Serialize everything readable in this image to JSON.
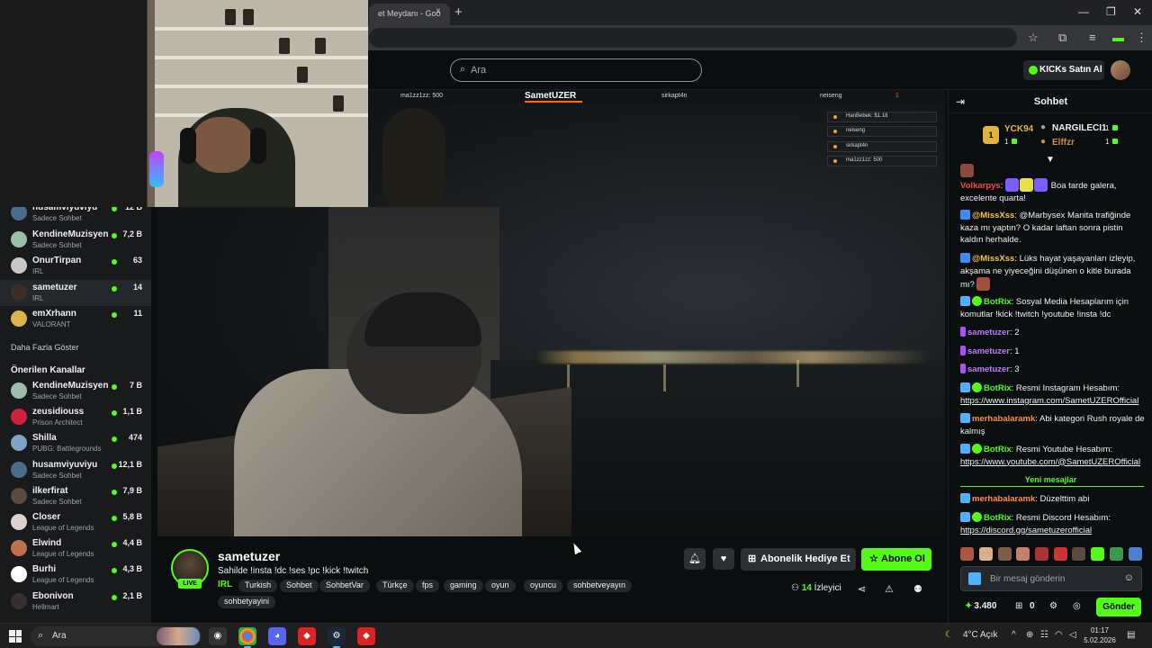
{
  "browser": {
    "tab_title": "et Meydanı - Goo",
    "tab_close": "×",
    "new_tab": "+",
    "window_controls": [
      "—",
      "❐",
      "✕"
    ]
  },
  "topnav": {
    "search_placeholder": "Ara",
    "kicks_button": "KICKs Satın Al"
  },
  "sidebar": {
    "following": [
      {
        "name": "husamviyuviyu",
        "category": "Sadece Sohbet",
        "viewers": "12 B",
        "avatar_color": "#4a6b8a"
      },
      {
        "name": "KendineMuzisyen",
        "category": "Sadece Sohbet",
        "viewers": "7,2 B",
        "avatar_color": "#9bbfa8"
      },
      {
        "name": "OnurTirpan",
        "category": "IRL",
        "viewers": "63",
        "avatar_color": "#c7c7c7"
      },
      {
        "name": "sametuzer",
        "category": "IRL",
        "viewers": "14",
        "avatar_color": "#3b2f28"
      },
      {
        "name": "emXrhann",
        "category": "VALORANT",
        "viewers": "11",
        "avatar_color": "#d9b54a"
      }
    ],
    "show_more": "Daha Fazla Göster",
    "recommended_title": "Önerilen Kanallar",
    "recommended": [
      {
        "name": "KendineMuzisyen",
        "category": "Sadece Sohbet",
        "viewers": "7 B",
        "avatar_color": "#9bbfa8"
      },
      {
        "name": "zeusidiouss",
        "category": "Prison Architect",
        "viewers": "1,1 B",
        "avatar_color": "#d02040"
      },
      {
        "name": "Shilla",
        "category": "PUBG: Battlegrounds",
        "viewers": "474",
        "avatar_color": "#7fa3c8"
      },
      {
        "name": "husamviyuviyu",
        "category": "Sadece Sohbet",
        "viewers": "12,1 B",
        "avatar_color": "#4a6b8a"
      },
      {
        "name": "ilkerfirat",
        "category": "Sadece Sohbet",
        "viewers": "7,9 B",
        "avatar_color": "#5a4a40"
      },
      {
        "name": "Closer",
        "category": "League of Legends",
        "viewers": "5,8 B",
        "avatar_color": "#e0d0d0"
      },
      {
        "name": "Elwind",
        "category": "League of Legends",
        "viewers": "4,4 B",
        "avatar_color": "#c0704a"
      },
      {
        "name": "Burhi",
        "category": "League of Legends",
        "viewers": "4,3 B",
        "avatar_color": "#ffffff"
      },
      {
        "name": "Ebonivon",
        "category": "Hellmart",
        "viewers": "2,1 B",
        "avatar_color": "#3a2f2f"
      }
    ]
  },
  "overlay": {
    "left_cell": "ma1zz1zz: 500",
    "main": "SametUZER",
    "cell_3": "sirkapt4n",
    "cell_4": "neiseng",
    "cell_5": "1",
    "list": [
      "HanBebek: $1.18",
      "neiseng",
      "sirkapt4n",
      "ma1zz1zz: 500"
    ]
  },
  "stream": {
    "live_badge": "LIVE",
    "name": "sametuzer",
    "title": "Sahilde  !insta !dc !ses !pc !kick !twitch",
    "category": "IRL",
    "tags": [
      "Turkish",
      "Sohbet",
      "SohbetVar",
      "Türkçe",
      "fps",
      "gaming",
      "oyun",
      "oyuncu",
      "sohbetveyayın",
      "sohbetyayini"
    ],
    "gift_button": "Abonelik Hediye Et",
    "subscribe_button": "Abone Ol",
    "viewer_count": "14",
    "viewer_label": "İzleyici"
  },
  "chat": {
    "title": "Sohbet",
    "leaderboard": {
      "rank": "1",
      "first": {
        "name": "YCK94",
        "count": "1"
      },
      "second": {
        "name": "NARGILECI1",
        "count": "1"
      },
      "third": {
        "name": "Elffzr",
        "count": "1"
      }
    },
    "messages": [
      {
        "user": "Volkarpys",
        "color": "#f44",
        "text": "Boa tarde galera, excelente quarta!"
      },
      {
        "user": "@MissXss",
        "color": "#f5c542",
        "text": "@Marbysex Manita trafiğinde kaza mı yaptın? O kadar laftan sonra pistin kaldın herhalde."
      },
      {
        "user": "@MissXss",
        "color": "#f5c542",
        "text": "Lüks hayat yaşayanları izleyip, akşama ne yiyeceğini düşünen o kitle burada mı?"
      },
      {
        "user": "BotRix",
        "color": "#53fc18",
        "text": "Sosyal Media Hesaplarım için komutlar !kick !twitch !youtube !insta !dc"
      },
      {
        "user": "sametuzer",
        "color": "#b97cff",
        "text": "2"
      },
      {
        "user": "sametuzer",
        "color": "#b97cff",
        "text": "1"
      },
      {
        "user": "sametuzer",
        "color": "#b97cff",
        "text": "3"
      },
      {
        "user": "BotRix",
        "color": "#53fc18",
        "text": "Resmi Instagram Hesabım:",
        "link": "https://www.instagram.com/SametUZEROfficial"
      },
      {
        "user": "merhabalaramk",
        "color": "#ff8c42",
        "text": "Abi kategori Rush royale de kalmış"
      },
      {
        "user": "BotRix",
        "color": "#53fc18",
        "text": "Resmi Youtube Hesabım:",
        "link": "https://www.youtube.com/@SametUZEROfficial"
      },
      {
        "user": "merhabalaramk",
        "color": "#ff8c42",
        "text": "Düzelttim abi"
      },
      {
        "user": "BotRix",
        "color": "#53fc18",
        "text": "Resmi Discord Hesabım:",
        "link": "https://discord.gg/sametuzerofficial"
      }
    ],
    "new_messages": "Yeni mesajlar",
    "input_placeholder": "Bir mesaj gönderin",
    "points": "3.480",
    "gift_count": "0",
    "send_button": "Gönder"
  },
  "taskbar": {
    "search": "Ara",
    "weather": "4°C  Açık",
    "time": "01:17",
    "date": "5.02.2026"
  }
}
